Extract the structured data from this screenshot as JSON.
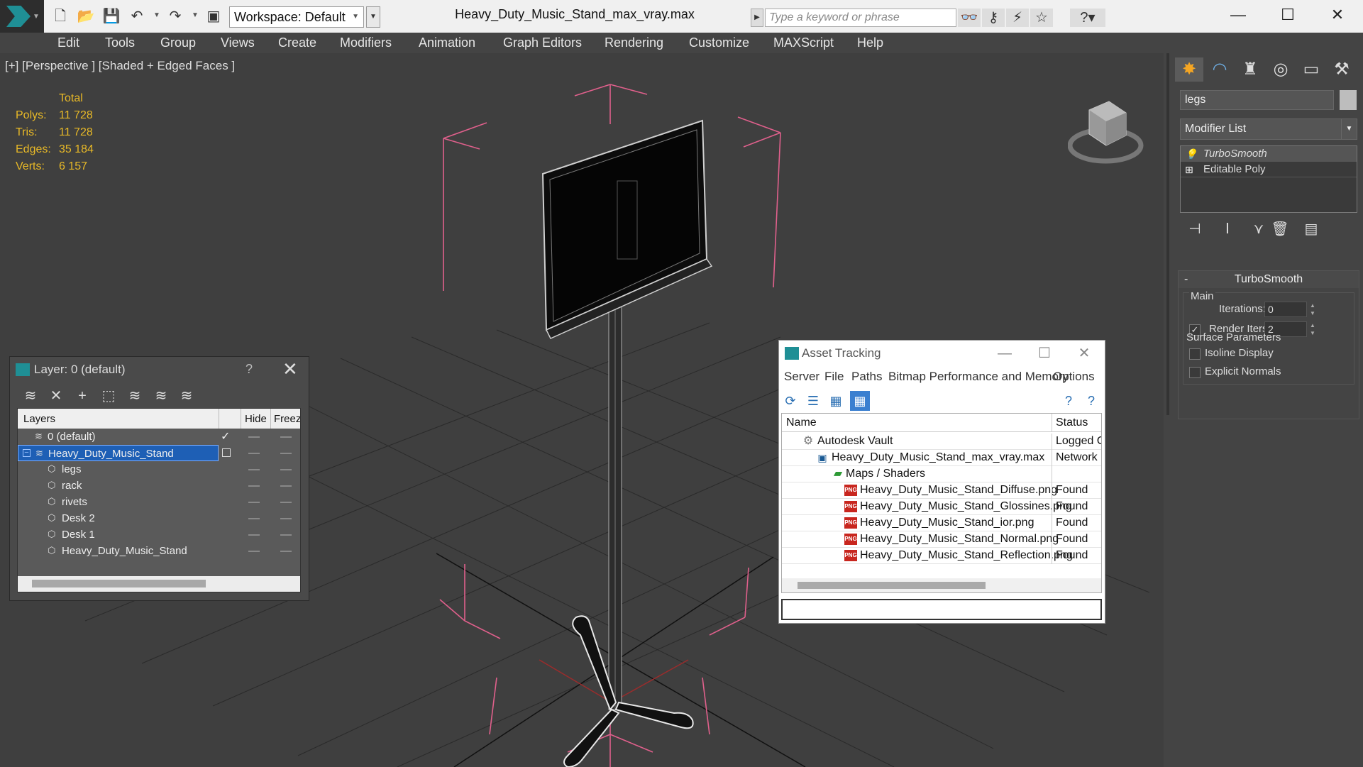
{
  "app": {
    "document_title": "Heavy_Duty_Music_Stand_max_vray.max",
    "workspace_label": "Workspace: Default",
    "search_placeholder": "Type a keyword or phrase"
  },
  "menu": [
    "Edit",
    "Tools",
    "Group",
    "Views",
    "Create",
    "Modifiers",
    "Animation",
    "Graph Editors",
    "Rendering",
    "Customize",
    "MAXScript",
    "Help"
  ],
  "viewport": {
    "label": "[+] [Perspective ] [Shaded + Edged Faces ]",
    "stats": {
      "header": "Total",
      "rows": [
        {
          "label": "Polys:",
          "value": "11 728"
        },
        {
          "label": "Tris:",
          "value": "11 728"
        },
        {
          "label": "Edges:",
          "value": "35 184"
        },
        {
          "label": "Verts:",
          "value": "6 157"
        }
      ]
    },
    "colors": {
      "stats": "#e8b927",
      "bbox": "#e0608c",
      "grid": "#262626",
      "axis_x": "#b03030"
    }
  },
  "command_panel": {
    "object_name": "legs",
    "modifier_list_label": "Modifier List",
    "stack": [
      {
        "label": "TurboSmooth",
        "icon": "bulb-icon",
        "selected": true
      },
      {
        "label": "Editable Poly",
        "icon": "plus-icon",
        "selected": false
      }
    ],
    "turbosmooth": {
      "title": "TurboSmooth",
      "main_label": "Main",
      "iterations_label": "Iterations:",
      "iterations_value": "0",
      "render_iters_label": "Render Iters:",
      "render_iters_value": "2",
      "render_iters_checked": true,
      "isoline_label": "Isoline Display",
      "explicit_normals_label": "Explicit Normals",
      "surface_params_label": "Surface Parameters"
    }
  },
  "layer_dialog": {
    "title": "Layer: 0 (default)",
    "help": "?",
    "columns": {
      "layers": "Layers",
      "hide": "Hide",
      "freeze": "Freeze"
    },
    "rows": [
      {
        "name": "0 (default)",
        "indent": 1,
        "current": true,
        "selected": false
      },
      {
        "name": "Heavy_Duty_Music_Stand",
        "indent": 1,
        "current": false,
        "selected": true,
        "expander": "−"
      },
      {
        "name": "legs",
        "indent": 2
      },
      {
        "name": "rack",
        "indent": 2
      },
      {
        "name": "rivets",
        "indent": 2
      },
      {
        "name": "Desk 2",
        "indent": 2
      },
      {
        "name": "Desk 1",
        "indent": 2
      },
      {
        "name": "Heavy_Duty_Music_Stand",
        "indent": 2
      }
    ]
  },
  "asset_tracking": {
    "title": "Asset Tracking",
    "menu": [
      "Server",
      "File",
      "Paths",
      "Bitmap Performance and Memory",
      "Options"
    ],
    "columns": {
      "name": "Name",
      "status": "Status"
    },
    "rows": [
      {
        "name": "Autodesk Vault",
        "status": "Logged O",
        "icon": "vault-icon",
        "indent": 1
      },
      {
        "name": "Heavy_Duty_Music_Stand_max_vray.max",
        "status": "Network F",
        "icon": "max-file-icon",
        "indent": 2
      },
      {
        "name": "Maps / Shaders",
        "status": "",
        "icon": "maps-icon",
        "indent": 3
      },
      {
        "name": "Heavy_Duty_Music_Stand_Diffuse.png",
        "status": "Found",
        "icon": "png-icon",
        "indent": 4
      },
      {
        "name": "Heavy_Duty_Music_Stand_Glossines.png",
        "status": "Found",
        "icon": "png-icon",
        "indent": 4
      },
      {
        "name": "Heavy_Duty_Music_Stand_ior.png",
        "status": "Found",
        "icon": "png-icon",
        "indent": 4
      },
      {
        "name": "Heavy_Duty_Music_Stand_Normal.png",
        "status": "Found",
        "icon": "png-icon",
        "indent": 4
      },
      {
        "name": "Heavy_Duty_Music_Stand_Reflection.png",
        "status": "Found",
        "icon": "png-icon",
        "indent": 4
      }
    ]
  }
}
